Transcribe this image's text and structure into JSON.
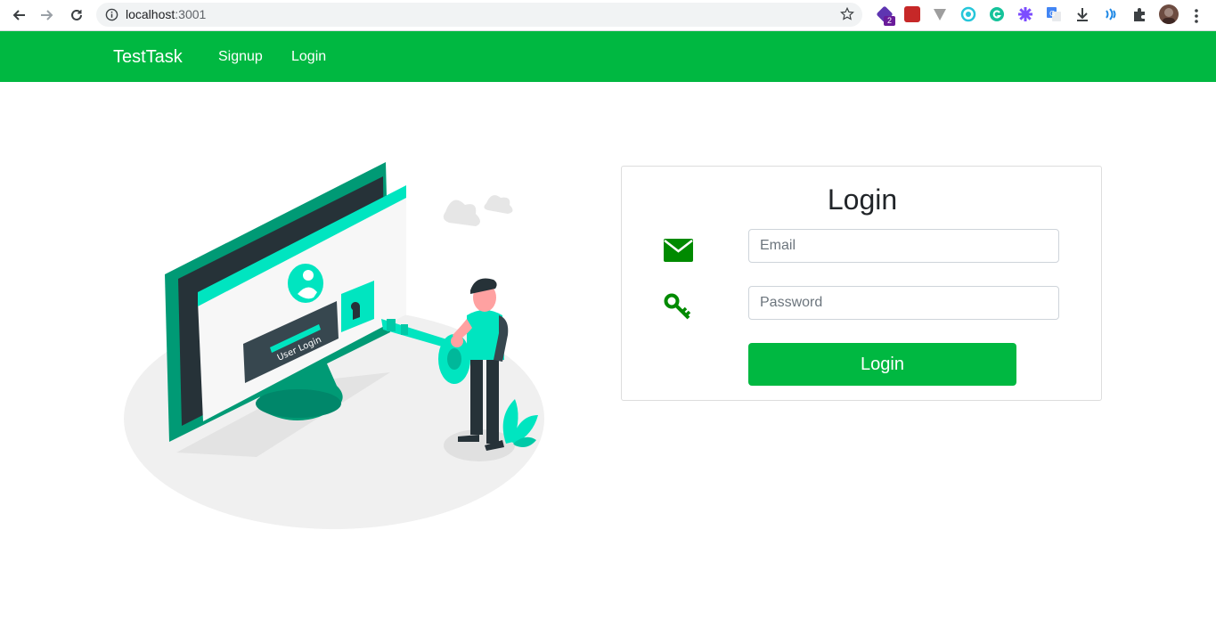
{
  "browser": {
    "url_host": "localhost",
    "url_port": ":3001",
    "extension_badge": "2",
    "icons": [
      "back-icon",
      "forward-icon",
      "reload-icon",
      "info-icon",
      "bookmark-star-icon",
      "extensions-puzzle-icon",
      "download-icon",
      "menu-dots-icon"
    ]
  },
  "navbar": {
    "brand": "TestTask",
    "links": [
      {
        "label": "Signup"
      },
      {
        "label": "Login"
      }
    ],
    "color": "#00b841"
  },
  "illustration": {
    "screen_label": "User Login",
    "accent": "#00e5c0",
    "dark": "#00997a"
  },
  "login": {
    "title": "Login",
    "email_placeholder": "Email",
    "password_placeholder": "Password",
    "button_label": "Login",
    "icon_color": "#008a00",
    "email_icon": "envelope-icon",
    "password_icon": "key-icon"
  }
}
